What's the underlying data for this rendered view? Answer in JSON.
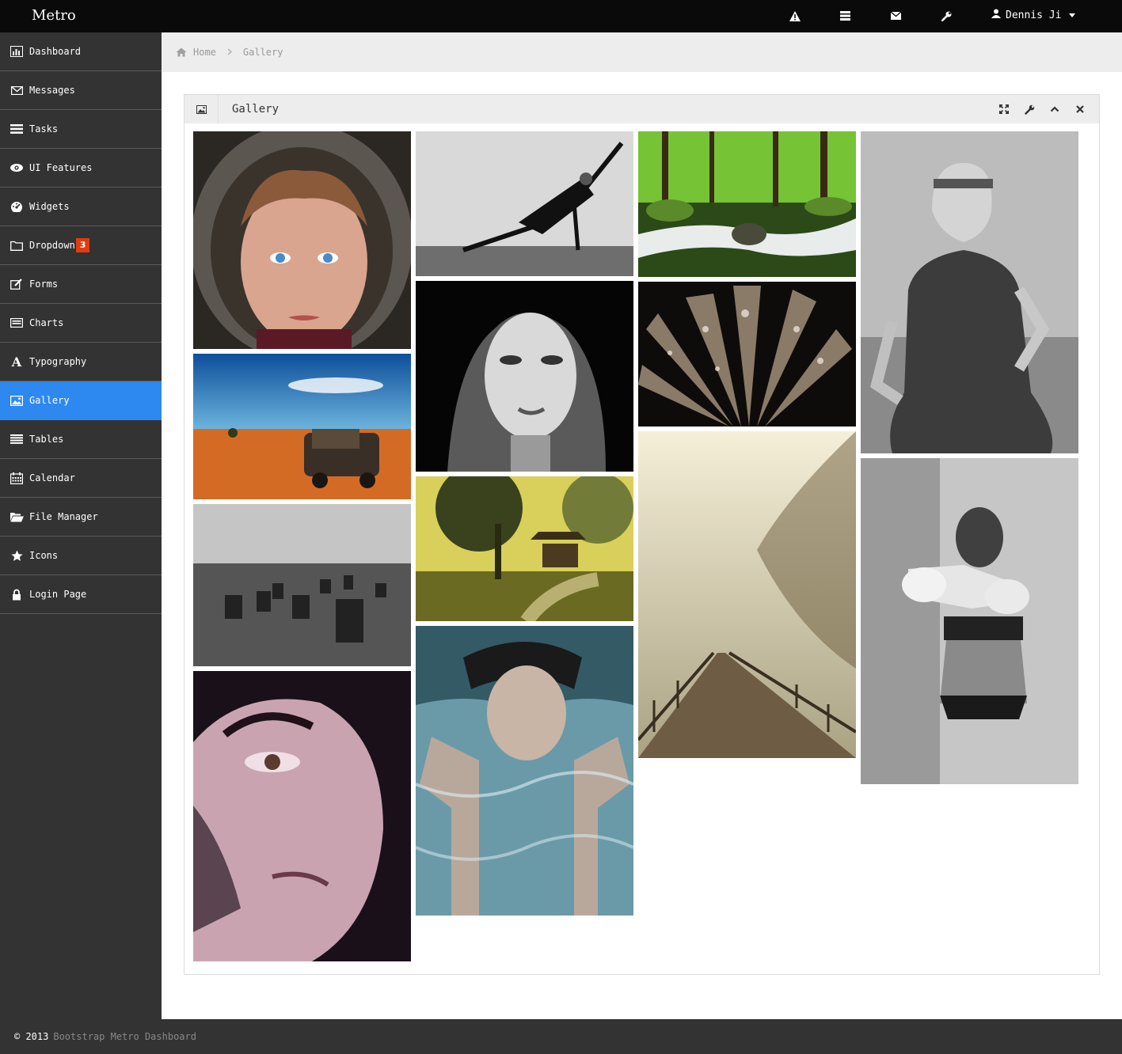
{
  "app": {
    "brand": "Metro"
  },
  "topbar": {
    "icons": [
      "warning-icon",
      "tasks-icon",
      "envelope-icon",
      "wrench-icon"
    ],
    "user": {
      "name": "Dennis Ji",
      "icon": "user-icon"
    }
  },
  "sidebar": {
    "items": [
      {
        "label": "Dashboard",
        "icon": "bar-chart-icon"
      },
      {
        "label": "Messages",
        "icon": "envelope-icon"
      },
      {
        "label": "Tasks",
        "icon": "tasks-icon"
      },
      {
        "label": "UI Features",
        "icon": "eye-icon"
      },
      {
        "label": "Widgets",
        "icon": "dashboard-icon"
      },
      {
        "label": "Dropdown",
        "icon": "folder-icon",
        "badge": "3"
      },
      {
        "label": "Forms",
        "icon": "edit-icon"
      },
      {
        "label": "Charts",
        "icon": "list-icon"
      },
      {
        "label": "Typography",
        "icon": "font-icon"
      },
      {
        "label": "Gallery",
        "icon": "picture-icon",
        "active": true
      },
      {
        "label": "Tables",
        "icon": "align-justify-icon"
      },
      {
        "label": "Calendar",
        "icon": "calendar-icon"
      },
      {
        "label": "File Manager",
        "icon": "folder-open-icon"
      },
      {
        "label": "Icons",
        "icon": "star-icon"
      },
      {
        "label": "Login Page",
        "icon": "lock-icon"
      }
    ]
  },
  "breadcrumb": {
    "home": "Home",
    "current": "Gallery"
  },
  "box": {
    "title": "Gallery",
    "icon": "picture-icon",
    "controls": [
      "fullscreen-icon",
      "wrench-icon",
      "chevron-up-icon",
      "close-icon"
    ]
  },
  "gallery": {
    "images": [
      "woman-fur-hood",
      "yoga-pose",
      "forest-stream",
      "woman-headband-dress",
      "desert-rusty-car",
      "woman-mannequin-face",
      "water-drops-flower",
      "chairs-in-field",
      "pagoda-park",
      "foggy-wooden-bridge",
      "woman-face-closeup",
      "boy-underwater",
      "boxer-woman"
    ]
  },
  "footer": {
    "copyright": "© 2013",
    "link": "Bootstrap Metro Dashboard"
  },
  "colors": {
    "accent": "#2d89ef",
    "sidebar": "#333333",
    "topbar": "#0a0a0a",
    "badge": "#e23b0f"
  }
}
